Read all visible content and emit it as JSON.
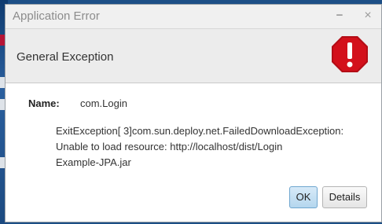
{
  "window": {
    "title": "Application Error",
    "minimize_glyph": "−",
    "close_glyph": "×"
  },
  "header": {
    "text": "General Exception",
    "icon": "error-stop-sign-icon"
  },
  "details": {
    "name_label": "Name:",
    "name_value": "com.Login",
    "message_lines": [
      "ExitException[ 3]com.sun.deploy.net.FailedDownloadException:",
      "Unable to load resource: http://localhost/dist/Login",
      "Example-JPA.jar"
    ]
  },
  "buttons": {
    "ok_label": "OK",
    "details_label": "Details"
  },
  "colors": {
    "error_red": "#d3101b",
    "ok_button": "#b4d6ee",
    "title_text": "#8c8c8c"
  }
}
